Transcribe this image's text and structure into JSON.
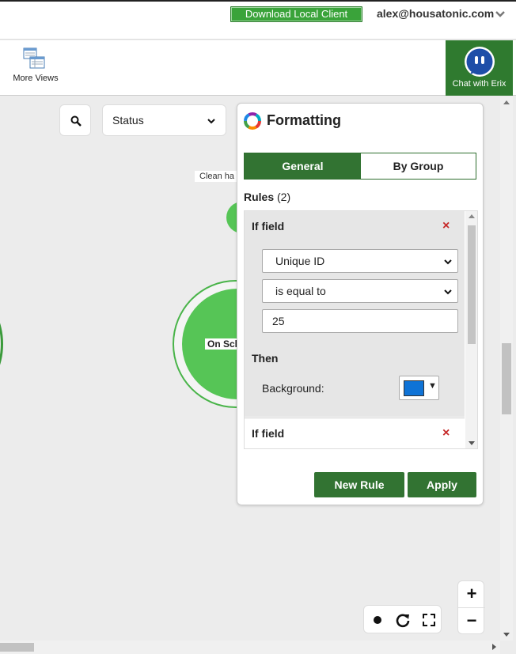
{
  "header": {
    "download_label": "Download Local Client",
    "user_email": "alex@housatonic.com"
  },
  "toolbar": {
    "more_views_label": "More Views",
    "chat_label": "Chat with Erix"
  },
  "canvas": {
    "status_select_value": "Status",
    "node_small_label": "Clean ha",
    "node_big_label": "On Sch"
  },
  "panel": {
    "title": "Formatting",
    "tabs": [
      {
        "label": "General",
        "active": true
      },
      {
        "label": "By Group",
        "active": false
      }
    ],
    "rules_heading": "Rules",
    "rules_count": "(2)",
    "rules": [
      {
        "if_label": "If field",
        "field_value": "Unique ID",
        "operator_value": "is equal to",
        "value": "25",
        "then_label": "Then",
        "background_label": "Background:",
        "background_color": "#0f73d6"
      },
      {
        "if_label": "If field"
      }
    ],
    "close_glyph": "×",
    "new_rule_label": "New Rule",
    "apply_label": "Apply"
  },
  "colors": {
    "brand_green": "#327332",
    "download_green": "#3aa33a",
    "node_green": "#56c556",
    "close_red": "#c62828"
  },
  "icons": {
    "search": "search-icon",
    "logo": "formatting-logo-icon",
    "chat": "chat-bubble-icon",
    "more_views": "more-views-icon"
  }
}
